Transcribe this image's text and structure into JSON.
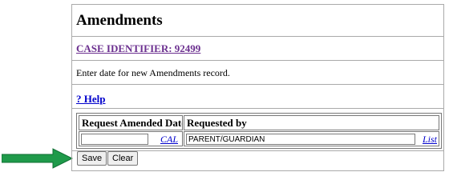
{
  "page_title": "Amendments",
  "case_identifier_link": "CASE IDENTIFIER: 92499",
  "instruction": "Enter date for new Amendments record.",
  "help_link": "? Help",
  "table": {
    "headers": [
      "Request Amended Date",
      "Requested by"
    ],
    "date_value": "",
    "cal_link": "CAL",
    "requested_by_value": "PARENT/GUARDIAN",
    "list_link": "List"
  },
  "buttons": {
    "save": "Save",
    "clear": "Clear"
  },
  "colors": {
    "arrow": "#1f9a4a",
    "link": "#0000cc",
    "visited_link": "#6b2f8f"
  }
}
